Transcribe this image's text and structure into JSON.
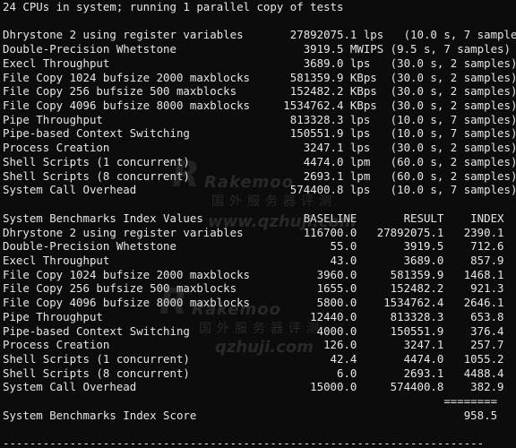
{
  "terminal": {
    "header": "24 CPUs in system; running 1 parallel copy of tests",
    "benchmark_results": [
      "Dhrystone 2 using register variables       27892075.1 lps   (10.0 s, 7 samples)",
      "Double-Precision Whetstone                   3919.5 MWIPS (9.5 s, 7 samples)",
      "Execl Throughput                             3689.0 lps   (30.0 s, 2 samples)",
      "File Copy 1024 bufsize 2000 maxblocks      581359.9 KBps  (30.0 s, 2 samples)",
      "File Copy 256 bufsize 500 maxblocks        152482.2 KBps  (30.0 s, 2 samples)",
      "File Copy 4096 bufsize 8000 maxblocks     1534762.4 KBps  (30.0 s, 2 samples)",
      "Pipe Throughput                            813328.3 lps   (10.0 s, 7 samples)",
      "Pipe-based Context Switching               150551.9 lps   (10.0 s, 7 samples)",
      "Process Creation                             3247.1 lps   (30.0 s, 2 samples)",
      "Shell Scripts (1 concurrent)                 4474.0 lpm   (60.0 s, 2 samples)",
      "Shell Scripts (8 concurrent)                 2693.1 lpm   (60.0 s, 2 samples)",
      "System Call Overhead                       574400.8 lps   (10.0 s, 7 samples)"
    ],
    "index_header": "System Benchmarks Index Values               BASELINE       RESULT    INDEX",
    "index_rows": [
      "Dhrystone 2 using register variables         116700.0   27892075.1   2390.1",
      "Double-Precision Whetstone                       55.0       3919.5    712.6",
      "Execl Throughput                                 43.0       3689.0    857.9",
      "File Copy 1024 bufsize 2000 maxblocks          3960.0     581359.9   1468.1",
      "File Copy 256 bufsize 500 maxblocks            1655.0     152482.2    921.3",
      "File Copy 4096 bufsize 8000 maxblocks          5800.0    1534762.4   2646.1",
      "Pipe Throughput                               12440.0     813328.3    653.8",
      "Pipe-based Context Switching                   4000.0     150551.9    376.4",
      "Process Creation                                126.0       3247.1    257.7",
      "Shell Scripts (1 concurrent)                     42.4       4474.0   1055.2",
      "Shell Scripts (8 concurrent)                      6.0       2693.1   4488.4",
      "System Call Overhead                          15000.0     574400.8    382.9"
    ],
    "separator": "                                                                  ========",
    "score_line": "System Benchmarks Index Score                                        958.5",
    "bottom_rule": "------------------------------------------------------------------------"
  },
  "watermarks": [
    {
      "brand": "Rakemoo",
      "cn": "国外服务器评测",
      "url": "www.qzhuji.com"
    },
    {
      "brand": "Rakemoo",
      "cn": "国外服务器评测",
      "url": "qzhuji.com"
    }
  ],
  "colors": {
    "background": "#0c0c0c",
    "text": "#e6e6e6"
  }
}
